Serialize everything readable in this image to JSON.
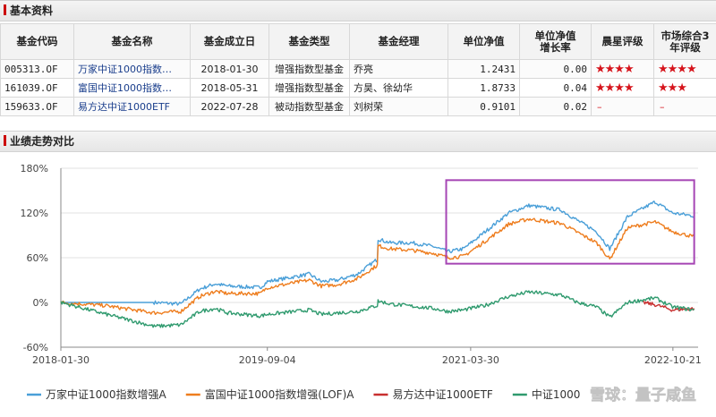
{
  "basic_info": {
    "title": "基本资料",
    "headers": [
      "基金代码",
      "基金名称",
      "基金成立日",
      "基金类型",
      "基金经理",
      "单位净值",
      "单位净值\n增长率",
      "晨星评级",
      "市场综合3\n年评级"
    ],
    "rows": [
      [
        "005313.OF",
        "万家中证1000指数…",
        "2018-01-30",
        "增强指数型基金",
        "乔亮",
        "1.2431",
        "0.00",
        "★★★★",
        "★★★★"
      ],
      [
        "161039.OF",
        "富国中证1000指数…",
        "2018-05-31",
        "增强指数型基金",
        "方昊、徐幼华",
        "1.8733",
        "0.04",
        "★★★★",
        "★★★"
      ],
      [
        "159633.OF",
        "易方达中证1000ETF",
        "2022-07-28",
        "被动指数型基金",
        "刘树荣",
        "0.9101",
        "0.02",
        "–",
        "–"
      ]
    ]
  },
  "performance": {
    "title": "业绩走势对比",
    "watermark": "雪球：量子咸鱼"
  },
  "chart_data": {
    "type": "line",
    "x_ticks": [
      "2018-01-30",
      "2019-09-04",
      "2021-03-30",
      "2022-10-21"
    ],
    "y_ticks": [
      "180%",
      "120%",
      "60%",
      "0%",
      "-60%"
    ],
    "ylim": [
      -60,
      180
    ],
    "x_range": [
      "2018-01-30",
      "2022-12-31"
    ],
    "grid": "horizontal",
    "legend_position": "bottom",
    "highlight_box": {
      "x_from": "2021-01-20",
      "x_to": "2022-12-20",
      "y_from": 52,
      "y_to": 164,
      "color": "#a646b4"
    },
    "series": [
      {
        "name": "万家中证1000指数增强A",
        "color": "#4a9fd8",
        "points": [
          [
            "2018-01-30",
            0
          ],
          [
            "2018-06-15",
            0
          ],
          [
            "2018-10-20",
            0
          ],
          [
            "2019-01-03",
            -2
          ],
          [
            "2019-02-25",
            18
          ],
          [
            "2019-04-10",
            25
          ],
          [
            "2019-05-15",
            22
          ],
          [
            "2019-08-15",
            20
          ],
          [
            "2019-09-04",
            28
          ],
          [
            "2019-12-31",
            38
          ],
          [
            "2020-02-03",
            28
          ],
          [
            "2020-03-20",
            30
          ],
          [
            "2020-05-15",
            38
          ],
          [
            "2020-07-10",
            58
          ],
          [
            "2020-07-12",
            85
          ],
          [
            "2020-08-15",
            80
          ],
          [
            "2020-10-15",
            80
          ],
          [
            "2020-12-15",
            75
          ],
          [
            "2021-01-25",
            68
          ],
          [
            "2021-03-10",
            72
          ],
          [
            "2021-05-10",
            95
          ],
          [
            "2021-07-15",
            120
          ],
          [
            "2021-09-10",
            130
          ],
          [
            "2021-12-10",
            124
          ],
          [
            "2022-01-25",
            110
          ],
          [
            "2022-03-20",
            95
          ],
          [
            "2022-04-26",
            72
          ],
          [
            "2022-06-15",
            115
          ],
          [
            "2022-09-01",
            135
          ],
          [
            "2022-10-20",
            120
          ],
          [
            "2022-12-20",
            116
          ]
        ]
      },
      {
        "name": "富国中证1000指数增强(LOF)A",
        "color": "#ee7d1e",
        "points": [
          [
            "2018-01-30",
            0
          ],
          [
            "2018-05-31",
            -4
          ],
          [
            "2018-10-20",
            -14
          ],
          [
            "2019-01-03",
            -12
          ],
          [
            "2019-02-25",
            8
          ],
          [
            "2019-04-10",
            15
          ],
          [
            "2019-05-15",
            12
          ],
          [
            "2019-08-15",
            12
          ],
          [
            "2019-09-04",
            20
          ],
          [
            "2019-12-31",
            30
          ],
          [
            "2020-02-03",
            22
          ],
          [
            "2020-03-20",
            24
          ],
          [
            "2020-05-15",
            32
          ],
          [
            "2020-07-10",
            50
          ],
          [
            "2020-07-12",
            76
          ],
          [
            "2020-08-15",
            72
          ],
          [
            "2020-10-15",
            70
          ],
          [
            "2020-12-15",
            66
          ],
          [
            "2021-01-25",
            60
          ],
          [
            "2021-03-10",
            62
          ],
          [
            "2021-05-10",
            82
          ],
          [
            "2021-07-15",
            105
          ],
          [
            "2021-09-10",
            112
          ],
          [
            "2021-12-10",
            106
          ],
          [
            "2022-01-25",
            94
          ],
          [
            "2022-03-20",
            80
          ],
          [
            "2022-04-26",
            58
          ],
          [
            "2022-06-15",
            100
          ],
          [
            "2022-09-01",
            108
          ],
          [
            "2022-10-20",
            95
          ],
          [
            "2022-12-20",
            88
          ]
        ]
      },
      {
        "name": "易方达中证1000ETF",
        "color": "#c82f2f",
        "points": [
          [
            "2022-07-28",
            0
          ],
          [
            "2022-09-01",
            -3
          ],
          [
            "2022-10-20",
            -10
          ],
          [
            "2022-12-20",
            -8
          ]
        ]
      },
      {
        "name": "中证1000",
        "color": "#2f9a6e",
        "points": [
          [
            "2018-01-30",
            0
          ],
          [
            "2018-05-31",
            -15
          ],
          [
            "2018-10-20",
            -32
          ],
          [
            "2019-01-03",
            -30
          ],
          [
            "2019-02-25",
            -12
          ],
          [
            "2019-04-10",
            -8
          ],
          [
            "2019-05-15",
            -14
          ],
          [
            "2019-08-15",
            -18
          ],
          [
            "2019-09-04",
            -16
          ],
          [
            "2019-12-31",
            -10
          ],
          [
            "2020-02-03",
            -16
          ],
          [
            "2020-03-20",
            -14
          ],
          [
            "2020-05-15",
            -12
          ],
          [
            "2020-07-10",
            -4
          ],
          [
            "2020-07-12",
            2
          ],
          [
            "2020-08-15",
            -2
          ],
          [
            "2020-10-15",
            -5
          ],
          [
            "2020-12-15",
            -8
          ],
          [
            "2021-01-25",
            -12
          ],
          [
            "2021-03-10",
            -10
          ],
          [
            "2021-05-10",
            -4
          ],
          [
            "2021-07-15",
            8
          ],
          [
            "2021-09-10",
            14
          ],
          [
            "2021-12-10",
            10
          ],
          [
            "2022-01-25",
            0
          ],
          [
            "2022-03-20",
            -6
          ],
          [
            "2022-04-26",
            -20
          ],
          [
            "2022-06-15",
            0
          ],
          [
            "2022-09-01",
            6
          ],
          [
            "2022-10-20",
            -6
          ],
          [
            "2022-12-20",
            -10
          ]
        ]
      }
    ]
  }
}
